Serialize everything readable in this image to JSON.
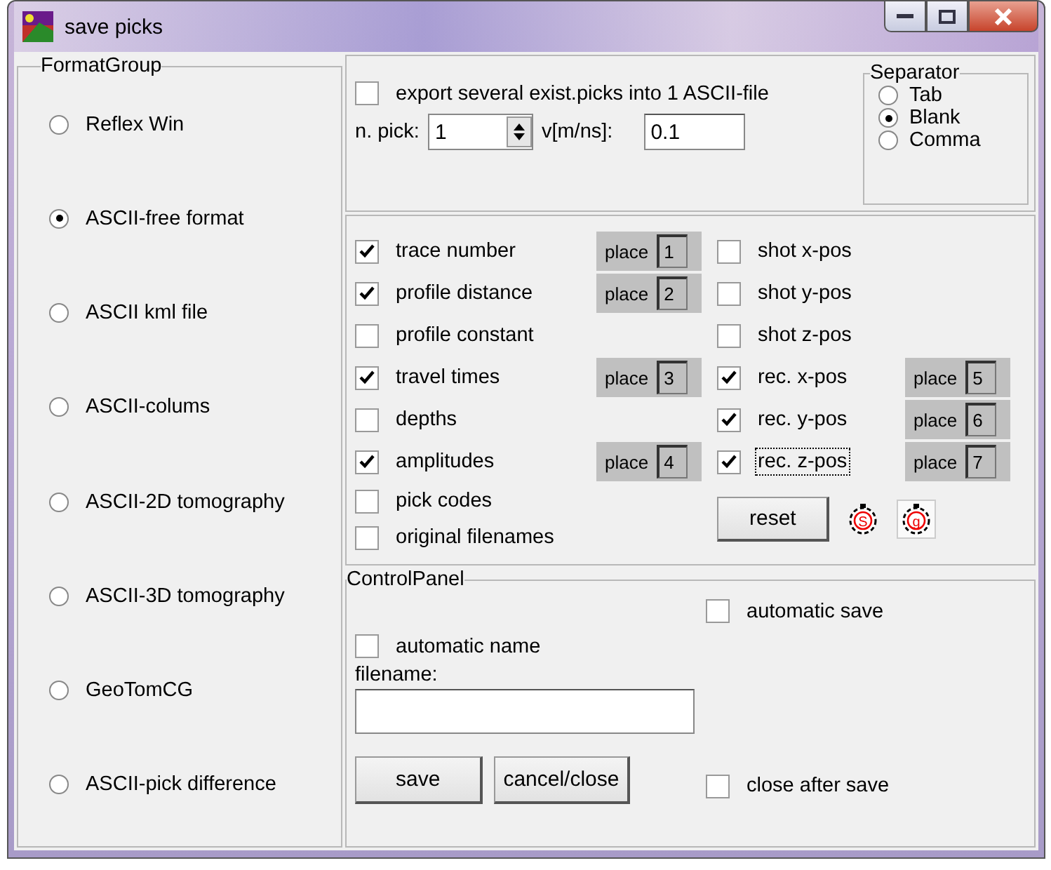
{
  "window": {
    "title": "save picks"
  },
  "format_group": {
    "title": "FormatGroup",
    "options": [
      {
        "label": "Reflex Win",
        "selected": false
      },
      {
        "label": "ASCII-free format",
        "selected": true
      },
      {
        "label": "ASCII kml file",
        "selected": false
      },
      {
        "label": "ASCII-colums",
        "selected": false
      },
      {
        "label": "ASCII-2D tomography",
        "selected": false
      },
      {
        "label": "ASCII-3D tomography",
        "selected": false
      },
      {
        "label": "GeoTomCG",
        "selected": false
      },
      {
        "label": "ASCII-pick difference",
        "selected": false
      }
    ]
  },
  "export": {
    "label": "export several exist.picks into 1 ASCII-file",
    "checked": false
  },
  "n_pick": {
    "label": "n. pick:",
    "value": "1"
  },
  "velocity": {
    "label": "v[m/ns]:",
    "value": "0.1"
  },
  "separator": {
    "title": "Separator",
    "options": [
      {
        "label": "Tab",
        "selected": false
      },
      {
        "label": "Blank",
        "selected": true
      },
      {
        "label": "Comma",
        "selected": false
      }
    ]
  },
  "fields_left": [
    {
      "label": "trace number",
      "checked": true,
      "place": {
        "label": "place",
        "number": "1"
      }
    },
    {
      "label": "profile distance",
      "checked": true,
      "place": {
        "label": "place",
        "number": "2"
      }
    },
    {
      "label": "profile constant",
      "checked": false
    },
    {
      "label": "travel times",
      "checked": true,
      "place": {
        "label": "place",
        "number": "3"
      }
    },
    {
      "label": "depths",
      "checked": false
    },
    {
      "label": "amplitudes",
      "checked": true,
      "place": {
        "label": "place",
        "number": "4"
      }
    },
    {
      "label": "pick codes",
      "checked": false
    },
    {
      "label": "original filenames",
      "checked": false
    }
  ],
  "fields_right": [
    {
      "label": "shot x-pos",
      "checked": false
    },
    {
      "label": "shot y-pos",
      "checked": false
    },
    {
      "label": "shot z-pos",
      "checked": false
    },
    {
      "label": "rec. x-pos",
      "checked": true,
      "place": {
        "label": "place",
        "number": "5"
      }
    },
    {
      "label": "rec. y-pos",
      "checked": true,
      "place": {
        "label": "place",
        "number": "6"
      }
    },
    {
      "label": "rec. z-pos",
      "checked": true,
      "focused": true,
      "place": {
        "label": "place",
        "number": "7"
      }
    }
  ],
  "reset_button": "reset",
  "timer_letters": [
    "S",
    "g"
  ],
  "control_panel": {
    "title": "ControlPanel",
    "automatic_save": {
      "label": "automatic save",
      "checked": false
    },
    "automatic_name": {
      "label": "automatic name",
      "checked": false
    },
    "filename": {
      "label": "filename:"
    },
    "buttons": [
      "save",
      "cancel/close"
    ],
    "close_after_save": {
      "label": "close after save",
      "checked": false
    }
  }
}
